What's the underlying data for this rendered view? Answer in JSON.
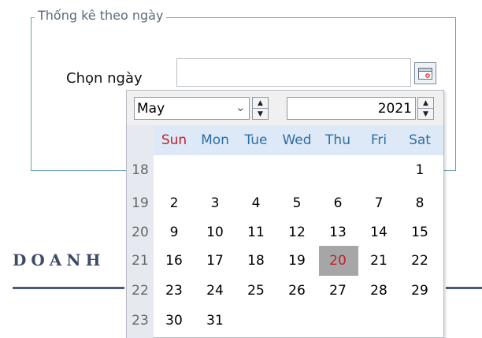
{
  "group": {
    "title": "Thống kê theo ngày"
  },
  "form": {
    "date_label": "Chọn ngày",
    "date_value": ""
  },
  "background": {
    "brand_text": "DOANH"
  },
  "calendar": {
    "month": "May",
    "year": "2021",
    "weekdays": [
      "Sun",
      "Mon",
      "Tue",
      "Wed",
      "Thu",
      "Fri",
      "Sat"
    ],
    "week_numbers": [
      "18",
      "19",
      "20",
      "21",
      "22",
      "23"
    ],
    "rows": [
      [
        "",
        "",
        "",
        "",
        "",
        "",
        "1"
      ],
      [
        "2",
        "3",
        "4",
        "5",
        "6",
        "7",
        "8"
      ],
      [
        "9",
        "10",
        "11",
        "12",
        "13",
        "14",
        "15"
      ],
      [
        "16",
        "17",
        "18",
        "19",
        "20",
        "21",
        "22"
      ],
      [
        "23",
        "24",
        "25",
        "26",
        "27",
        "28",
        "29"
      ],
      [
        "30",
        "31",
        "",
        "",
        "",
        "",
        ""
      ]
    ],
    "today": "20",
    "colors": {
      "sunday": "#c0212b",
      "weekday_header": "#2f6ea5",
      "header_band": "#dde9f6",
      "today_bg": "#a6a6a6"
    }
  },
  "icons": {
    "calendar_button": "calendar-icon",
    "month_dropdown": "chevron-down-icon",
    "spin_up": "spin-up-icon",
    "spin_down": "spin-down-icon"
  }
}
